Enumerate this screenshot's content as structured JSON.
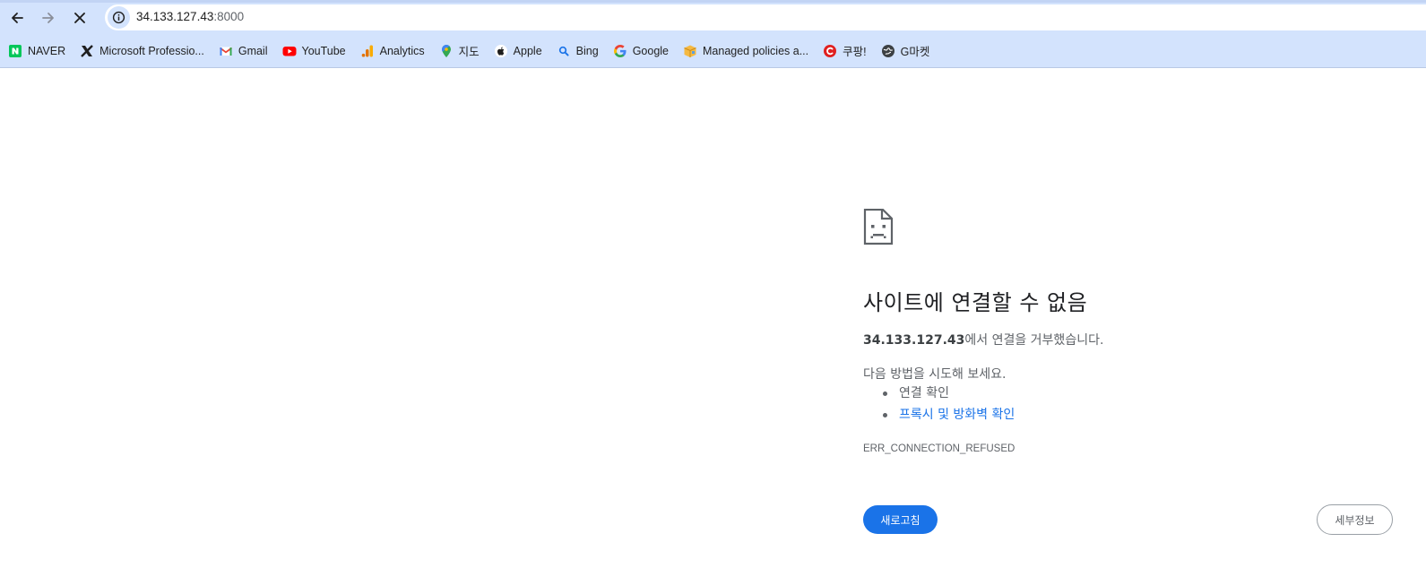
{
  "browser": {
    "url_host": "34.133.127.43",
    "url_port": ":8000",
    "icons": {
      "back": "back-arrow-icon",
      "forward": "forward-arrow-icon",
      "stop": "close-icon",
      "site_info": "info-icon"
    }
  },
  "bookmarks": [
    {
      "label": "NAVER",
      "icon": "naver-icon"
    },
    {
      "label": "Microsoft Professio...",
      "icon": "x-logo-icon"
    },
    {
      "label": "Gmail",
      "icon": "gmail-icon"
    },
    {
      "label": "YouTube",
      "icon": "youtube-icon"
    },
    {
      "label": "Analytics",
      "icon": "analytics-icon"
    },
    {
      "label": "지도",
      "icon": "maps-pin-icon"
    },
    {
      "label": "Apple",
      "icon": "apple-icon"
    },
    {
      "label": "Bing",
      "icon": "search-icon"
    },
    {
      "label": "Google",
      "icon": "google-icon"
    },
    {
      "label": "Managed policies a...",
      "icon": "box-icon"
    },
    {
      "label": "쿠팡!",
      "icon": "coupang-icon"
    },
    {
      "label": "G마켓",
      "icon": "globe-icon"
    }
  ],
  "error": {
    "icon": "sad-document-icon",
    "title": "사이트에 연결할 수 없음",
    "host": "34.133.127.43",
    "description_suffix": "에서 연결을 거부했습니다.",
    "suggestions_heading": "다음 방법을 시도해 보세요.",
    "suggestions": [
      {
        "label": "연결 확인",
        "link": false
      },
      {
        "label": "프록시 및 방화벽 확인",
        "link": true
      }
    ],
    "code": "ERR_CONNECTION_REFUSED",
    "reload_label": "새로고침",
    "details_label": "세부정보"
  },
  "colors": {
    "toolbar_bg": "#d3e3fd",
    "primary_button": "#1a73e8",
    "link": "#1a73e8",
    "text_primary": "#202124",
    "text_secondary": "#5f6368"
  }
}
